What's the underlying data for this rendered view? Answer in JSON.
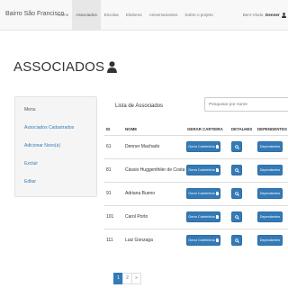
{
  "navbar": {
    "brand": "Bairro São Francisco",
    "items": [
      {
        "label": "Home",
        "active": false
      },
      {
        "label": "Associados",
        "active": true
      },
      {
        "label": "Escolas",
        "active": false
      },
      {
        "label": "Eleitores",
        "active": false
      },
      {
        "label": "Aniversariantes",
        "active": false
      },
      {
        "label": "Sobre o projeto",
        "active": false
      }
    ],
    "welcome_prefix": "Bem-Vindo,",
    "welcome_user": "Denner",
    "user_icon": "user-icon"
  },
  "page_title": "ASSOCIADOS",
  "sidebar": {
    "heading": "Menu",
    "links": [
      "Associados Cadastrados",
      "Adicionar Novo(a)",
      "Excluir",
      "Editar"
    ]
  },
  "list": {
    "title": "Lista de Associados",
    "search_placeholder": "Pesquisar por nome",
    "headers": {
      "id": "ID",
      "nome": "NOME",
      "gerar": "GERAR CARTEIRA",
      "detalhes": "DETALHES",
      "dependentes": "DEPENDENTES"
    },
    "rows": [
      {
        "id": "61",
        "nome": "Denner Machado"
      },
      {
        "id": "81",
        "nome": "Cássio Huggenthiler de Costa"
      },
      {
        "id": "91",
        "nome": "Adriana Bueno"
      },
      {
        "id": "101",
        "nome": "Carol Porto"
      },
      {
        "id": "111",
        "nome": "Luiz Gonzaga"
      }
    ],
    "gerar_label": "Gerar Carteirinha",
    "dependentes_label": "Dependentes",
    "detalhes_icon": "search-icon",
    "gerar_icon": "file-icon"
  },
  "pagination": {
    "pages": [
      "1",
      "2"
    ],
    "next": "»",
    "active_page": "1"
  },
  "colors": {
    "primary": "#337ab7",
    "navbar_bg": "#f8f8f8",
    "sidebar_bg": "#f5f5f5"
  }
}
